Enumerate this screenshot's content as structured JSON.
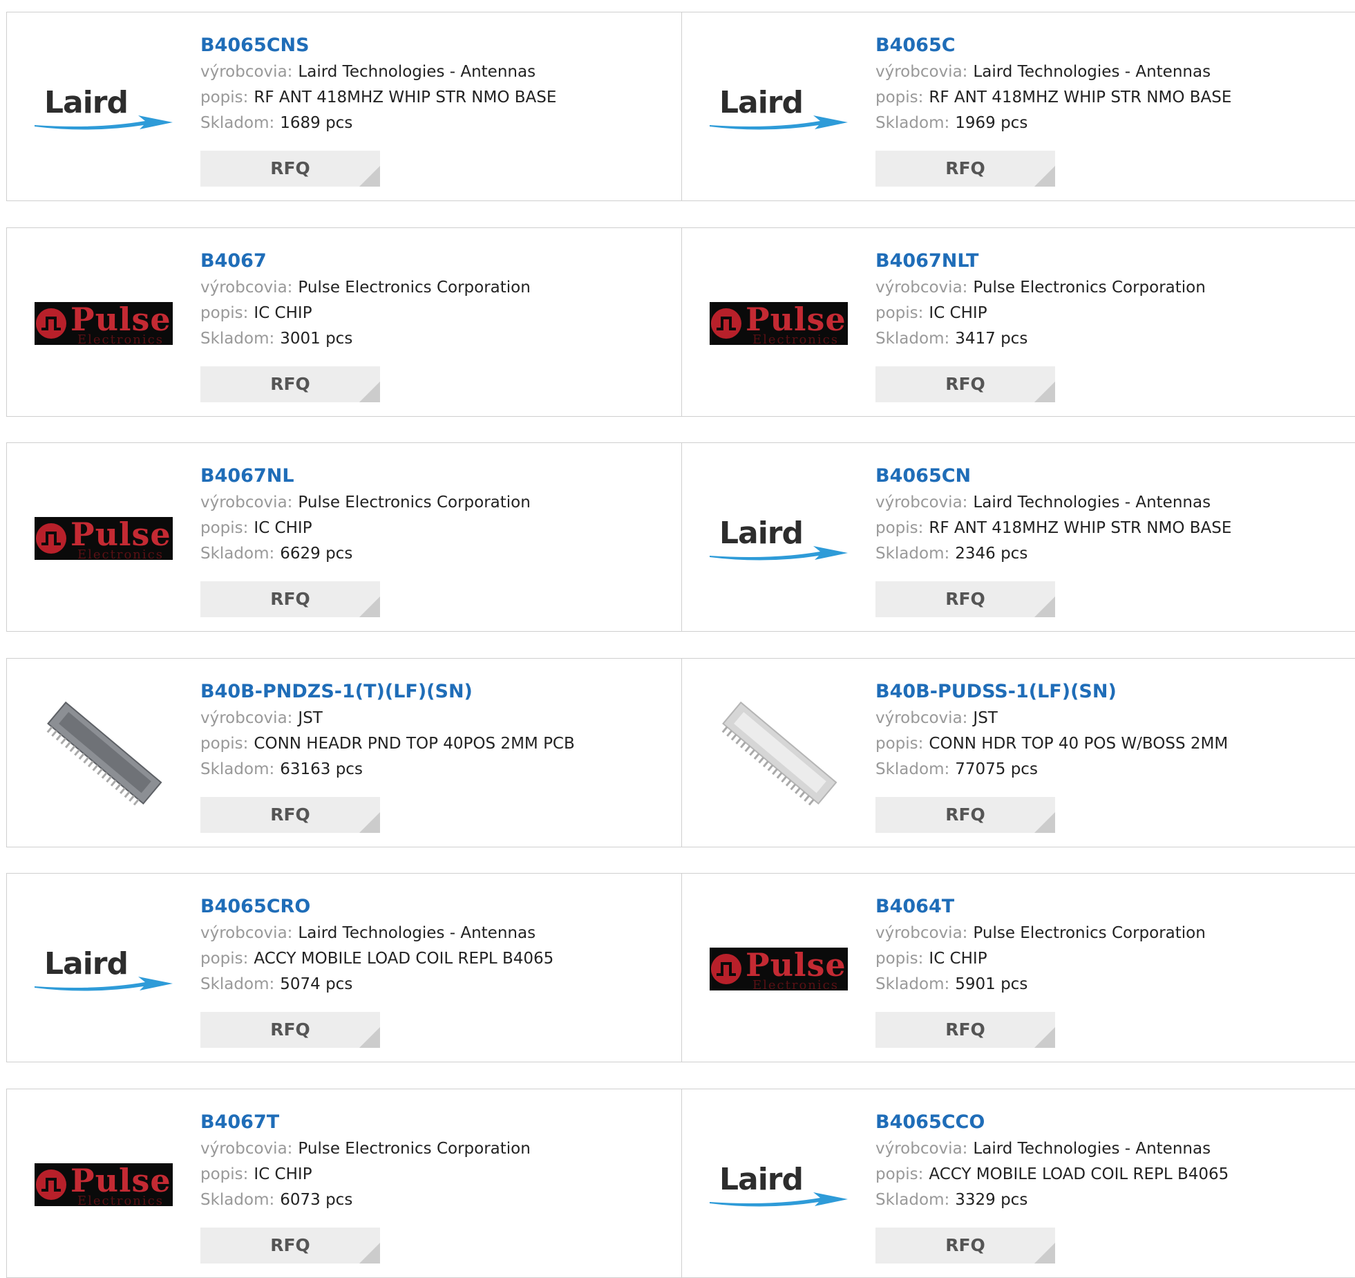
{
  "labels": {
    "manufacturer": "výrobcovia:",
    "description": "popis:",
    "stock": "Skladom:",
    "rfq": "RFQ"
  },
  "products": [
    {
      "pn": "B4065CNS",
      "manufacturer": "Laird Technologies - Antennas",
      "description": "RF ANT 418MHZ WHIP STR NMO BASE",
      "stock": "1689 pcs",
      "image": "laird-logo"
    },
    {
      "pn": "B4065C",
      "manufacturer": "Laird Technologies - Antennas",
      "description": "RF ANT 418MHZ WHIP STR NMO BASE",
      "stock": "1969 pcs",
      "image": "laird-logo"
    },
    {
      "pn": "B4067",
      "manufacturer": "Pulse Electronics Corporation",
      "description": "IC CHIP",
      "stock": "3001 pcs",
      "image": "pulse-logo"
    },
    {
      "pn": "B4067NLT",
      "manufacturer": "Pulse Electronics Corporation",
      "description": "IC CHIP",
      "stock": "3417 pcs",
      "image": "pulse-logo"
    },
    {
      "pn": "B4067NL",
      "manufacturer": "Pulse Electronics Corporation",
      "description": "IC CHIP",
      "stock": "6629 pcs",
      "image": "pulse-logo"
    },
    {
      "pn": "B4065CN",
      "manufacturer": "Laird Technologies - Antennas",
      "description": "RF ANT 418MHZ WHIP STR NMO BASE",
      "stock": "2346 pcs",
      "image": "laird-logo"
    },
    {
      "pn": "B40B-PNDZS-1(T)(LF)(SN)",
      "manufacturer": "JST",
      "description": "CONN HEADR PND TOP 40POS 2MM PCB",
      "stock": "63163 pcs",
      "image": "connector-dark"
    },
    {
      "pn": "B40B-PUDSS-1(LF)(SN)",
      "manufacturer": "JST",
      "description": "CONN HDR TOP 40 POS W/BOSS 2MM",
      "stock": "77075 pcs",
      "image": "connector-light"
    },
    {
      "pn": "B4065CRO",
      "manufacturer": "Laird Technologies - Antennas",
      "description": "ACCY MOBILE LOAD COIL REPL B4065",
      "stock": "5074 pcs",
      "image": "laird-logo"
    },
    {
      "pn": "B4064T",
      "manufacturer": "Pulse Electronics Corporation",
      "description": "IC CHIP",
      "stock": "5901 pcs",
      "image": "pulse-logo"
    },
    {
      "pn": "B4067T",
      "manufacturer": "Pulse Electronics Corporation",
      "description": "IC CHIP",
      "stock": "6073 pcs",
      "image": "pulse-logo"
    },
    {
      "pn": "B4065CCO",
      "manufacturer": "Laird Technologies - Antennas",
      "description": "ACCY MOBILE LOAD COIL REPL B4065",
      "stock": "3329 pcs",
      "image": "laird-logo"
    }
  ],
  "logos": {
    "laird": {
      "word": "Laird",
      "tm": "™"
    },
    "pulse": {
      "word": "Pulse",
      "sub": "Electronics"
    }
  },
  "colors": {
    "link": "#1f6db8",
    "label": "#999999",
    "rfq_bg": "#ededed",
    "border": "#cfcfcf",
    "laird_swoosh": "#2e9bd8",
    "pulse_red": "#c42a33"
  }
}
